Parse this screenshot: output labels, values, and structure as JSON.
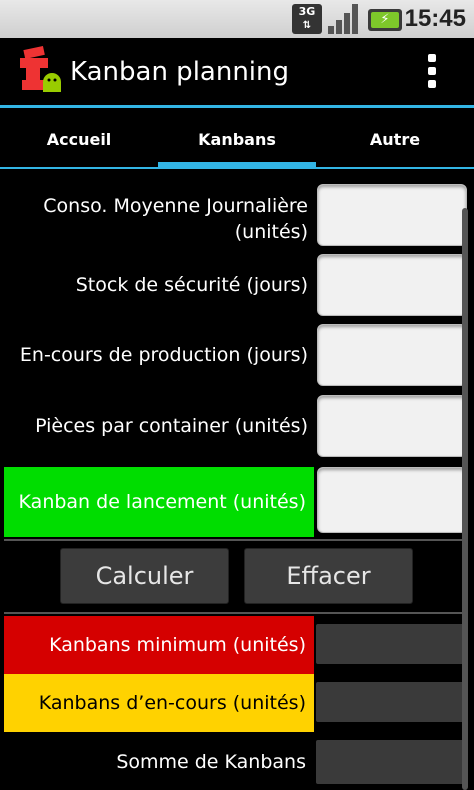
{
  "status_bar": {
    "network": "3G",
    "network_arrows": "⇅",
    "battery_glyph": "⚡",
    "time": "15:45"
  },
  "app": {
    "title": "Kanban planning"
  },
  "tabs": [
    {
      "label": "Accueil",
      "selected": false
    },
    {
      "label": "Kanbans",
      "selected": true
    },
    {
      "label": "Autre",
      "selected": false
    }
  ],
  "inputs": {
    "conso_label": "Conso. Moyenne Journalière\n(unités)",
    "conso_value": "",
    "stock_label": "Stock de sécurité (jours)",
    "stock_value": "",
    "encours_label": "En-cours de production (jours)",
    "encours_value": "",
    "pieces_label": "Pièces par container (unités)",
    "pieces_value": "",
    "lancement_label": "Kanban de lancement (unités)",
    "lancement_value": ""
  },
  "buttons": {
    "calculer": "Calculer",
    "effacer": "Effacer"
  },
  "results": {
    "minimum_label": "Kanbans minimum (unités)",
    "minimum_value": "",
    "encours_label": "Kanbans d’en-cours (unités)",
    "encours_value": "",
    "somme_label": "Somme de Kanbans",
    "somme_value": ""
  },
  "colors": {
    "accent": "#33b5e5",
    "green": "#00dd00",
    "red": "#d50000",
    "yellow": "#ffd200"
  }
}
